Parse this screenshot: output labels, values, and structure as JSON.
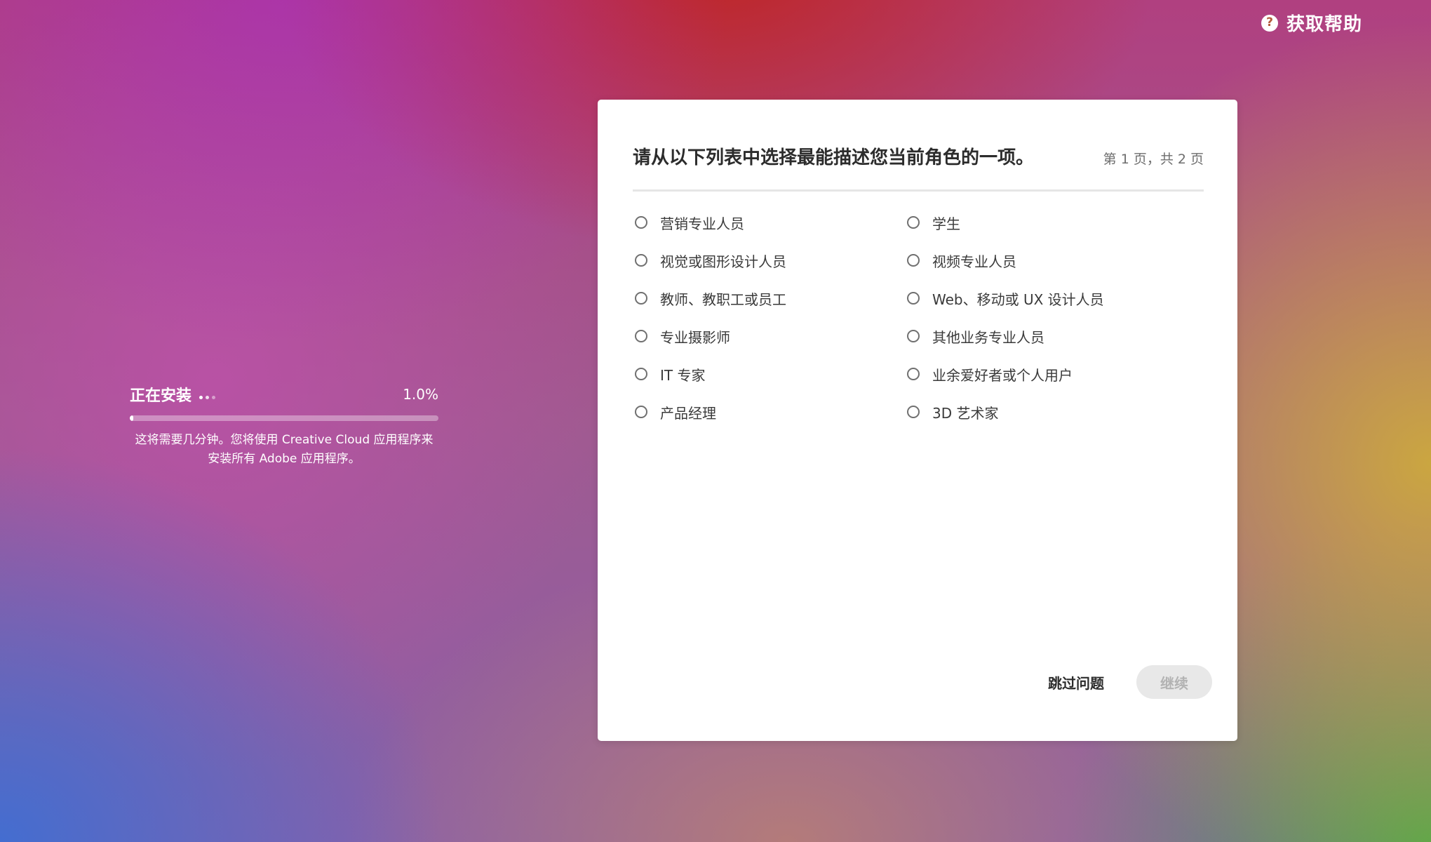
{
  "help": {
    "icon": "question-circle-icon",
    "label": "获取帮助"
  },
  "install": {
    "title": "正在安装",
    "percent_text": "1.0%",
    "progress": 0.01,
    "description": "这将需要几分钟。您将使用 Creative Cloud 应用程序来安装所有 Adobe 应用程序。"
  },
  "dialog": {
    "title": "请从以下列表中选择最能描述您当前角色的一项。",
    "page_indicator": "第 1 页，共 2 页",
    "options": [
      {
        "label": "营销专业人员"
      },
      {
        "label": "学生"
      },
      {
        "label": "视觉或图形设计人员"
      },
      {
        "label": "视频专业人员"
      },
      {
        "label": "教师、教职工或员工"
      },
      {
        "label": "Web、移动或 UX 设计人员"
      },
      {
        "label": "专业摄影师"
      },
      {
        "label": "其他业务专业人员"
      },
      {
        "label": "IT 专家"
      },
      {
        "label": "业余爱好者或个人用户"
      },
      {
        "label": "产品经理"
      },
      {
        "label": "3D 艺术家"
      }
    ],
    "skip_label": "跳过问题",
    "continue_label": "继续"
  },
  "colors": {
    "card_bg": "#ffffff",
    "title_text": "#2c2c2c",
    "disabled_button_bg": "#e8e8e8",
    "disabled_button_text": "#b3b3b3"
  }
}
